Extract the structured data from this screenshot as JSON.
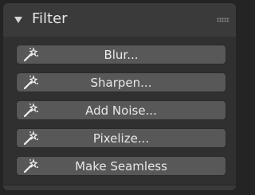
{
  "panel": {
    "title": "Filter",
    "collapse_icon": "triangle-down-icon",
    "grip_icon": "drag-grip-icon"
  },
  "buttons": [
    {
      "label": "Blur...",
      "icon": "magic-wand-icon"
    },
    {
      "label": "Sharpen...",
      "icon": "magic-wand-icon"
    },
    {
      "label": "Add Noise...",
      "icon": "magic-wand-icon"
    },
    {
      "label": "Pixelize...",
      "icon": "magic-wand-icon"
    },
    {
      "label": "Make Seamless",
      "icon": "magic-wand-icon"
    }
  ]
}
